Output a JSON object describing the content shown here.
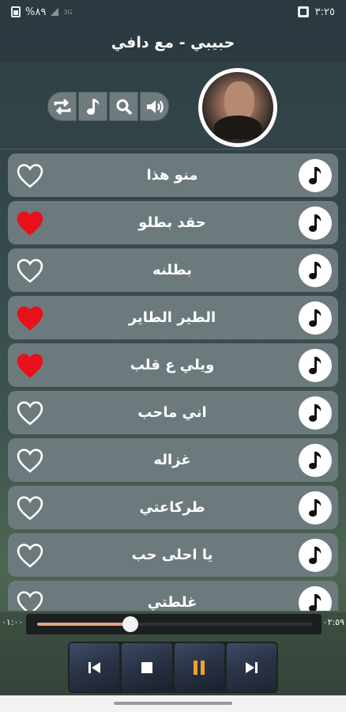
{
  "status_bar": {
    "time": "٣:٢٥",
    "battery": "%٨٩",
    "network": "3G"
  },
  "header": {
    "title": "حبيبي - مع دافي"
  },
  "controls": [
    {
      "icon": "repeat-icon"
    },
    {
      "icon": "music-note-icon"
    },
    {
      "icon": "search-icon"
    },
    {
      "icon": "volume-icon"
    }
  ],
  "songs": [
    {
      "title": "منو هذا",
      "favorite": false
    },
    {
      "title": "حقد بطلو",
      "favorite": true
    },
    {
      "title": "بطلنه",
      "favorite": false
    },
    {
      "title": "الطير الطاير",
      "favorite": true
    },
    {
      "title": "ويلي ع قلب",
      "favorite": true
    },
    {
      "title": "اني ماحب",
      "favorite": false
    },
    {
      "title": "غزاله",
      "favorite": false
    },
    {
      "title": "طركاعتي",
      "favorite": false
    },
    {
      "title": "يا احلى حب",
      "favorite": false
    },
    {
      "title": "غلطتي",
      "favorite": false
    }
  ],
  "player": {
    "elapsed": "٠١:٠٠",
    "duration": "٠٢:٥٩",
    "progress": 0.34,
    "progress_color": "#e3a27f"
  },
  "colors": {
    "favorite": "#e8101a",
    "row": "#6d7a7d"
  }
}
